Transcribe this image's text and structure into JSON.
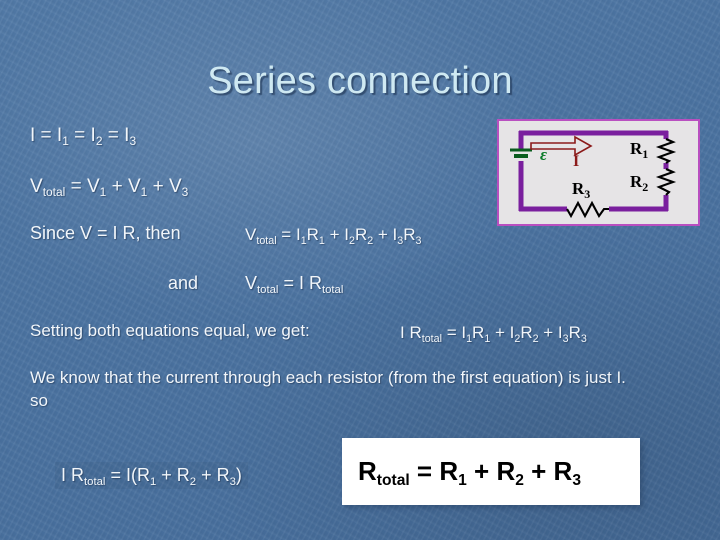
{
  "slide": {
    "title": "Series connection",
    "background_color": "#4a72a0",
    "title_color": "#cfe9f2"
  },
  "body": {
    "current_equation": "I = I1 = I2 = I3",
    "current_equation_parts": {
      "lhs": "I",
      "terms": [
        "I",
        "I",
        "I"
      ],
      "subs": [
        "1",
        "2",
        "3"
      ]
    },
    "voltage_equation": "Vtotal = V1 + V1 + V3",
    "since_label": "Since V = I R, then",
    "since_equation": "Vtotal = I1R1 + I2R2 + I3R3",
    "and_label": "and",
    "and_equation": "Vtotal = I Rtotal",
    "setting_label": "Setting  both equations equal, we get:",
    "setting_equation": "I Rtotal = I1R1 + I2R2 + I3R3",
    "know_paragraph": "We know that the current through each resistor (from the first equation) is just I.",
    "so_label": "so",
    "final_left_equation": "I Rtotal = I(R1 + R2 + R3)"
  },
  "result": {
    "equation": "Rtotal = R1 + R2 + R3",
    "box_background": "#ffffff",
    "text_color": "#000000"
  },
  "circuit": {
    "frame_border_color": "#b94fc0",
    "frame_fill_color": "#e6e4e6",
    "wire_color": "#7a1f9e",
    "battery_color": "#0a5c1e",
    "emf_label": "ε",
    "emf_label_color": "#0a7a28",
    "current_label": "I",
    "current_label_color": "#8b1a1a",
    "arrow_color": "#8b1a1a",
    "resistors": [
      {
        "label": "R",
        "sub": "1",
        "position": "right-upper"
      },
      {
        "label": "R",
        "sub": "2",
        "position": "right-lower"
      },
      {
        "label": "R",
        "sub": "3",
        "position": "bottom"
      }
    ],
    "resistor_label_color": "#000000"
  }
}
